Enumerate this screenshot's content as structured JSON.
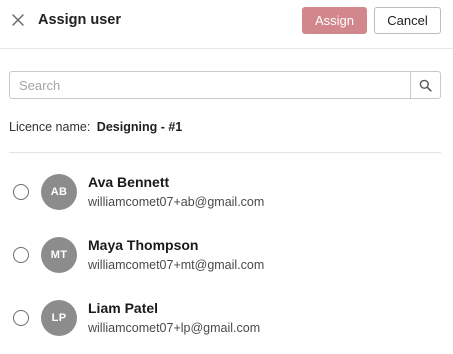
{
  "header": {
    "title": "Assign user",
    "close_icon": "close-icon",
    "assign_label": "Assign",
    "cancel_label": "Cancel"
  },
  "search": {
    "placeholder": "Search",
    "value": "",
    "icon": "search-icon"
  },
  "licence": {
    "label": "Licence name:",
    "value": "Designing - #1"
  },
  "colors": {
    "assign_button": "#d1878c",
    "avatar": "#8c8c8c"
  },
  "users": [
    {
      "initials": "AB",
      "name": "Ava Bennett",
      "email": "williamcomet07+ab@gmail.com",
      "selected": false
    },
    {
      "initials": "MT",
      "name": "Maya Thompson",
      "email": "williamcomet07+mt@gmail.com",
      "selected": false
    },
    {
      "initials": "LP",
      "name": "Liam Patel",
      "email": "williamcomet07+lp@gmail.com",
      "selected": false
    }
  ]
}
